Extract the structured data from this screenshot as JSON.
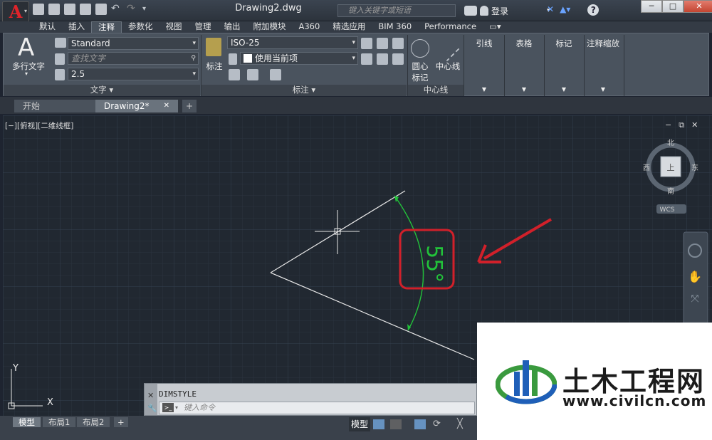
{
  "titlebar": {
    "app_button": "A",
    "doc_title": "Drawing2.dwg",
    "search_placeholder": "键入关键字或短语",
    "signin_label": "登录",
    "help_label": "?",
    "win_min": "─",
    "win_max": "□",
    "win_close": "✕"
  },
  "ribbon_tabs": [
    "默认",
    "插入",
    "注释",
    "参数化",
    "视图",
    "管理",
    "输出",
    "附加模块",
    "A360",
    "精选应用",
    "BIM 360",
    "Performance"
  ],
  "ribbon": {
    "text_panel": {
      "big_button_label": "多行文字",
      "big_button_glyph": "A",
      "style_value": "Standard",
      "find_placeholder": "查找文字",
      "height_value": "2.5",
      "panel_title": "文字 ▾"
    },
    "dim_panel": {
      "big_button_label": "标注",
      "dimstyle_value": "ISO-25",
      "layer_value": "使用当前项",
      "panel_title": "标注 ▾"
    },
    "centerline_panel": {
      "center_mark_label_1": "圆心",
      "center_mark_label_2": "标记",
      "centerline_label": "中心线",
      "panel_title": "中心线"
    },
    "collapsed_panels": [
      "引线",
      "表格",
      "标记",
      "注释缩放"
    ]
  },
  "doc_tabs": {
    "start": "开始",
    "drawing": "Drawing2*",
    "close_glyph": "✕",
    "new_glyph": "+"
  },
  "viewport": {
    "label": "[−][俯视][二维线框]",
    "viewcube": {
      "north": "北",
      "south": "南",
      "east": "东",
      "west": "西",
      "top": "上",
      "wcs": "WCS"
    },
    "ucs": {
      "x": "X",
      "y": "Y"
    },
    "dimension_text": "55°",
    "vp_controls": [
      "−",
      "⧉",
      "✕"
    ]
  },
  "command": {
    "history": "DIMSTYLE",
    "placeholder": "键入命令"
  },
  "layout_tabs": [
    "模型",
    "布局1",
    "布局2",
    "+"
  ],
  "status": {
    "model_button": "模型"
  },
  "watermark": {
    "name": "土木工程网",
    "url": "www.civilcn.com"
  },
  "colors": {
    "canvas_bg": "#212831",
    "grid": "#2b3340",
    "geometry": "#e8e8e8",
    "dimension": "#22c33a",
    "highlight_box": "#d1202a",
    "arrow": "#d1202a"
  }
}
